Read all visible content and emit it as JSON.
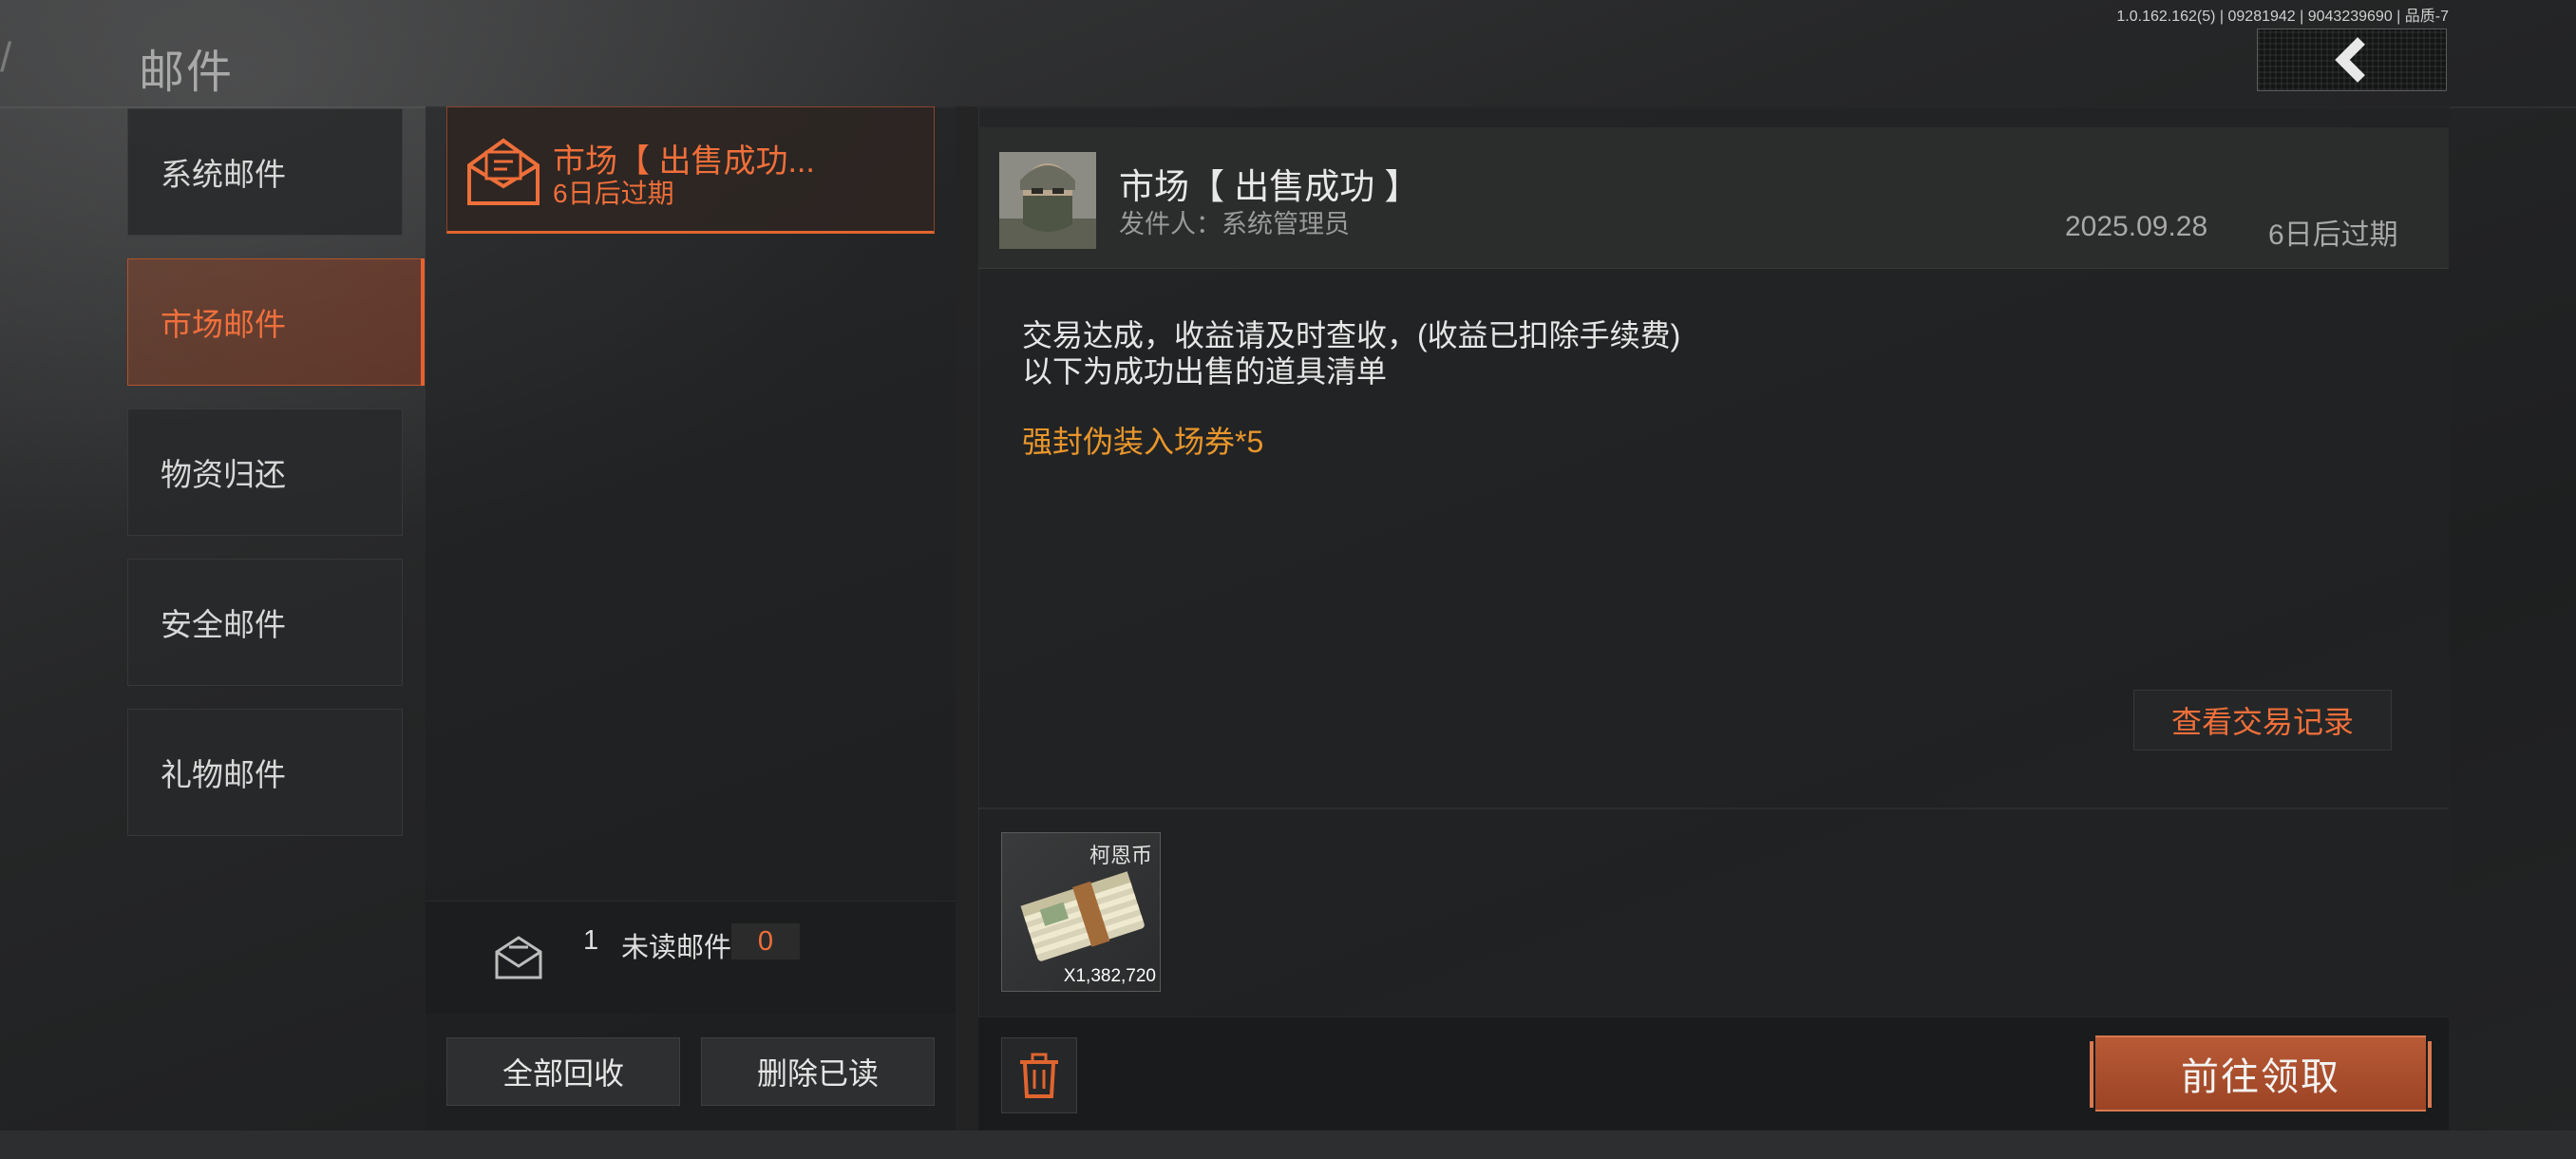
{
  "header": {
    "title": "邮件",
    "version": "1.0.162.162(5) | 09281942 | 9043239690 | 品质-7",
    "back_icon": "chevron-left-icon"
  },
  "categories": [
    {
      "label": "系统邮件"
    },
    {
      "label": "市场邮件",
      "active": true
    },
    {
      "label": "物资归还"
    },
    {
      "label": "安全邮件"
    },
    {
      "label": "礼物邮件"
    }
  ],
  "mail_list": {
    "items": [
      {
        "title": "市场【 出售成功...",
        "expiry": "6日后过期",
        "icon": "envelope-open-icon"
      }
    ],
    "stats": {
      "count": "1",
      "unread_label": "未读邮件",
      "unread_count": "0"
    },
    "actions": {
      "recover_all": "全部回收",
      "delete_read": "删除已读"
    }
  },
  "detail": {
    "title": "市场【 出售成功 】",
    "sender": "发件人：系统管理员",
    "date": "2025.09.28",
    "expiry": "6日后过期",
    "body_line1": "交易达成，收益请及时查收，(收益已扣除手续费)",
    "body_line2": "以下为成功出售的道具清单",
    "item_line": "强封伪装入场券*5",
    "view_records": "查看交易记录",
    "reward": {
      "name": "柯恩币",
      "quantity": "X1,382,720"
    },
    "claim": "前往领取",
    "delete_icon": "trash-icon"
  },
  "colors": {
    "accent": "#ef6f3a",
    "gold": "#e8962c",
    "claim": "#b85a35"
  }
}
